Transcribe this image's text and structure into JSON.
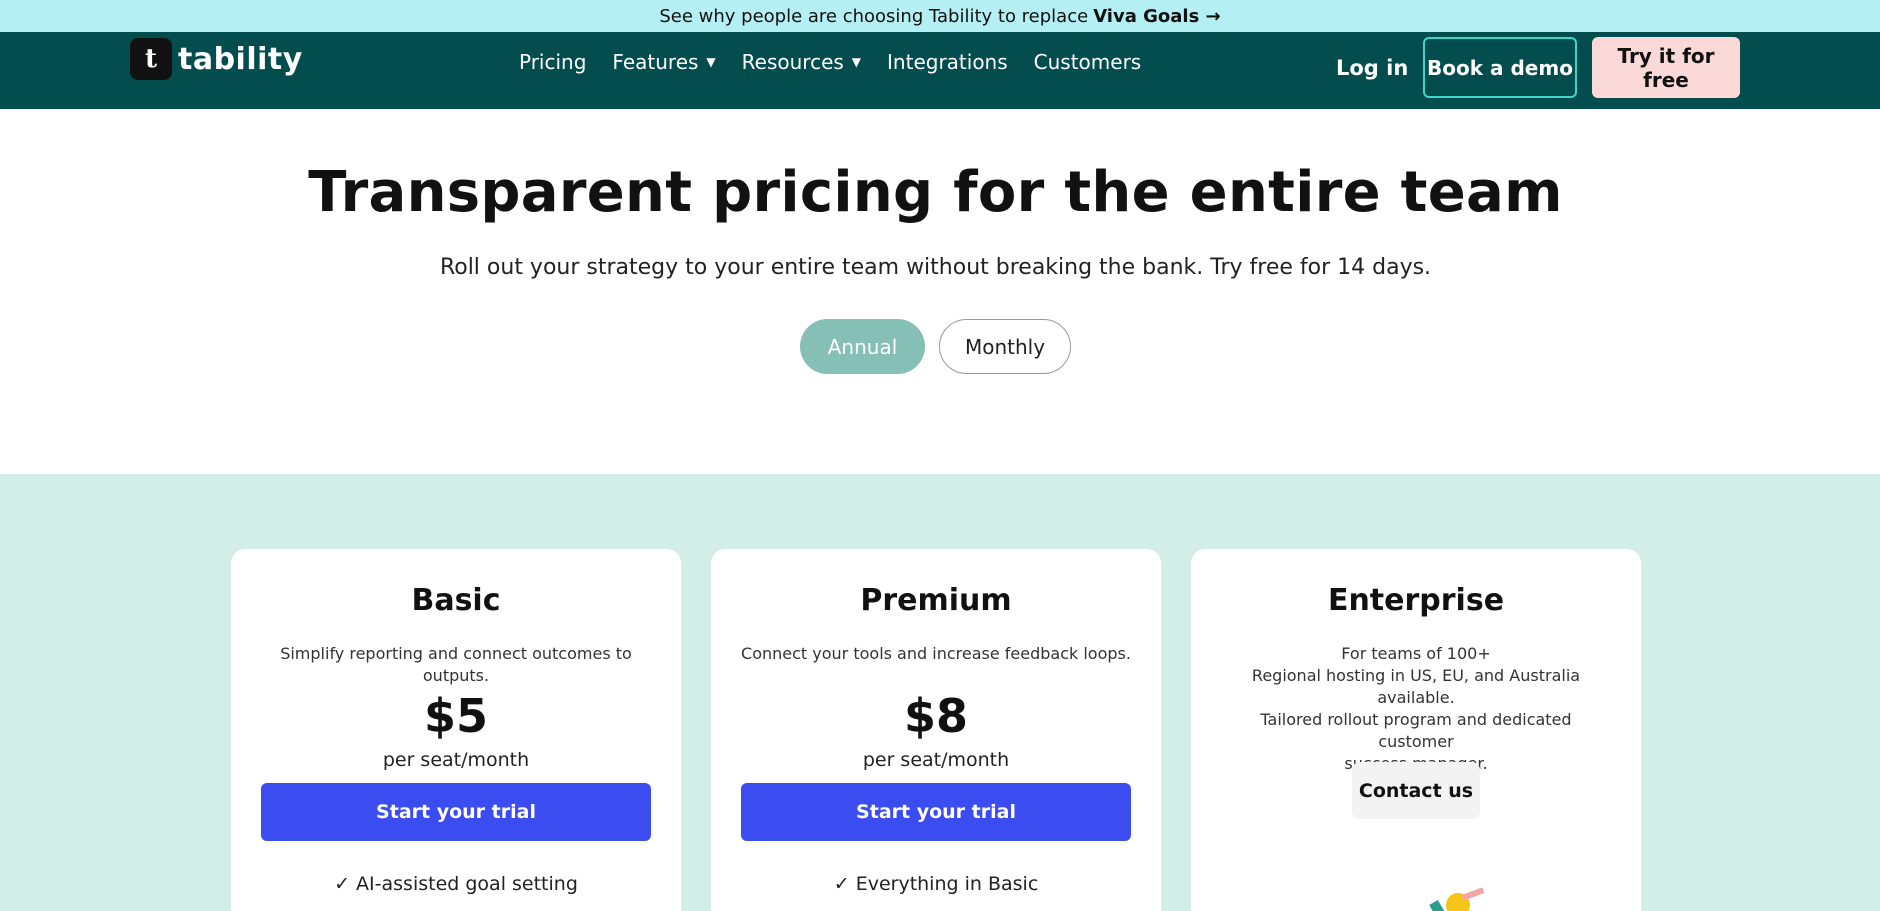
{
  "announcement": {
    "text": "See why people are choosing Tability to replace",
    "link": "Viva Goals →"
  },
  "nav": {
    "logo_text": "tability",
    "logo_glyph": "t",
    "links": [
      {
        "label": "Pricing"
      },
      {
        "label": "Features",
        "caret": "▼"
      },
      {
        "label": "Resources",
        "caret": "▼"
      },
      {
        "label": "Integrations"
      },
      {
        "label": "Customers"
      }
    ],
    "login": "Log in",
    "demo": "Book a demo",
    "try": "Try it for free"
  },
  "hero": {
    "title": "Transparent pricing for the entire team",
    "subtitle": "Roll out your strategy to your entire team without breaking the bank. Try free for 14 days.",
    "toggle": {
      "annual": "Annual",
      "monthly": "Monthly",
      "selected": "Annual"
    }
  },
  "plans": [
    {
      "name": "Basic",
      "description": "Simplify reporting and connect outcomes to outputs.",
      "price": "$5",
      "per": "per seat/month",
      "cta": "Start your trial",
      "feature": "✓ AI-assisted goal setting"
    },
    {
      "name": "Premium",
      "description": "Connect your tools and increase feedback loops.",
      "price": "$8",
      "per": "per seat/month",
      "cta": "Start your trial",
      "feature": "✓ Everything in Basic"
    },
    {
      "name": "Enterprise",
      "description_lines": [
        "For teams of 100+",
        "Regional hosting in US, EU, and Australia available.",
        "Tailored rollout program and dedicated customer",
        "success manager."
      ],
      "cta": "Contact us"
    }
  ],
  "colors": {
    "announce_bg": "#b4eff4",
    "nav_bg": "#034d4f",
    "pricing_bg": "#d3ede7",
    "cta_blue": "#3b4cf0",
    "try_pink": "#fcd9d9",
    "toggle_active": "#86bfb6"
  }
}
